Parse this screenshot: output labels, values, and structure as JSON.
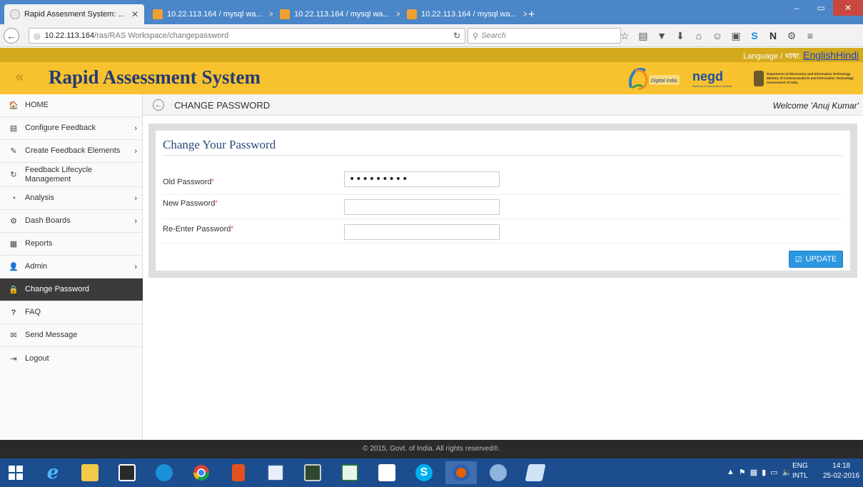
{
  "browser": {
    "tabs": [
      {
        "label": "Rapid Assesment System: ...",
        "active": true
      },
      {
        "label": "10.22.113.164 / mysql wa...",
        "active": false
      },
      {
        "label": "10.22.113.164 / mysql wa...",
        "active": false
      },
      {
        "label": "10.22.113.164 / mysql wa...",
        "active": false
      }
    ],
    "new_tab": "+",
    "url_host": "10.22.113.164",
    "url_path": "/ras/RAS Workspace/changepassword",
    "search_placeholder": "Search"
  },
  "header": {
    "language_label": "Language / भाषा:",
    "language_links": "EnglishHindi",
    "collapse_glyph": "«",
    "title": "Rapid Assessment System",
    "logo_di_text": "Digital India",
    "logo_negd_text": "negd",
    "logo_negd_sub": "National e-Governance Division",
    "logo_deity_line1": "Department of Electronics and Information Technology",
    "logo_deity_line2": "Ministry of Communications and Information Technology",
    "logo_deity_line3": "Government of India"
  },
  "sidebar": {
    "items": [
      {
        "label": "HOME",
        "icon": "home-icon",
        "glyph": "🏠",
        "chevron": false
      },
      {
        "label": "Configure Feedback",
        "icon": "file-icon",
        "glyph": "▤",
        "chevron": true
      },
      {
        "label": "Create Feedback Elements",
        "icon": "pencil-icon",
        "glyph": "✎",
        "chevron": true
      },
      {
        "label": "Feedback Lifecycle Management",
        "icon": "refresh-icon",
        "glyph": "↻",
        "chevron": false
      },
      {
        "label": "Analysis",
        "icon": "pie-chart-icon",
        "glyph": "◔",
        "chevron": true
      },
      {
        "label": "Dash Boards",
        "icon": "dashboard-icon",
        "glyph": "⚙",
        "chevron": true
      },
      {
        "label": "Reports",
        "icon": "report-icon",
        "glyph": "▦",
        "chevron": false
      },
      {
        "label": "Admin",
        "icon": "user-icon",
        "glyph": "👤",
        "chevron": true
      },
      {
        "label": "Change Password",
        "icon": "lock-icon",
        "glyph": "🔒",
        "chevron": false,
        "active": true
      },
      {
        "label": "FAQ",
        "icon": "question-icon",
        "glyph": "?",
        "chevron": false
      },
      {
        "label": "Send Message",
        "icon": "envelope-icon",
        "glyph": "✉",
        "chevron": false
      },
      {
        "label": "Logout",
        "icon": "logout-icon",
        "glyph": "⇥",
        "chevron": false
      }
    ],
    "chevron_glyph": "›"
  },
  "content": {
    "page_title": "CHANGE PASSWORD",
    "welcome": "Welcome 'Anuj Kumar'",
    "panel_title": "Change Your Password",
    "fields": [
      {
        "label": "Old Password",
        "value": "•••••••••"
      },
      {
        "label": "New Password",
        "value": ""
      },
      {
        "label": "Re-Enter Password",
        "value": ""
      }
    ],
    "required_mark": "*",
    "update_label": "UPDATE"
  },
  "footer": {
    "text": "© 2015, Govt. of India. All rights reserved®."
  },
  "taskbar": {
    "lang_top": "ENG",
    "lang_bottom": "INTL",
    "time": "14:18",
    "date": "25-02-2016"
  },
  "colors": {
    "header_yellow": "#f7c22d",
    "title_blue": "#243a73",
    "update_blue": "#2b97e0",
    "sidebar_active": "#3b3b3b"
  }
}
